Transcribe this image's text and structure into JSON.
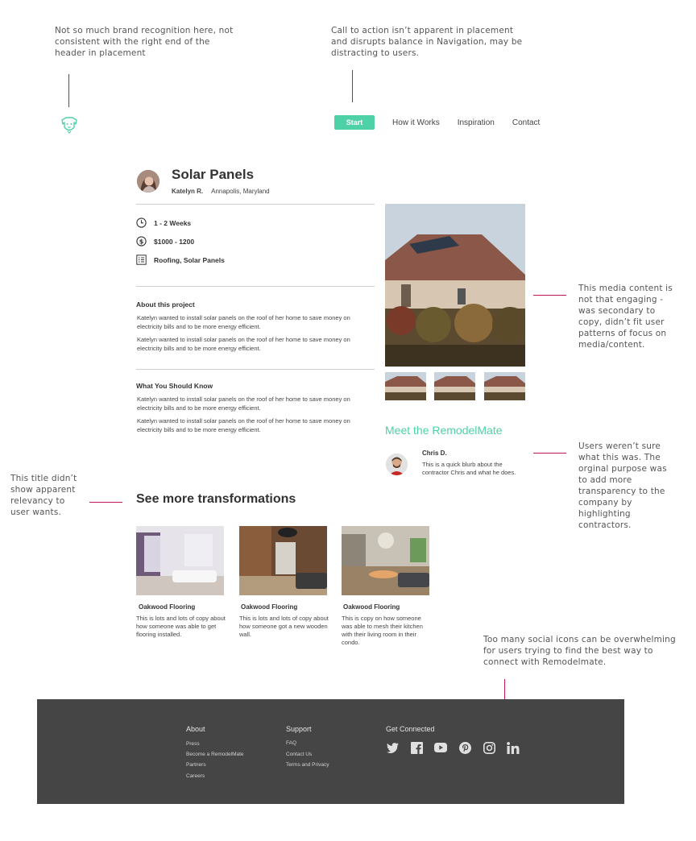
{
  "annotations": {
    "brand": "Not so much brand recognition here, not consistent with the right end of the header in placement",
    "cta": "Call to action isn’t apparent in placement and disrupts balance in Navigation, may be distracting to users.",
    "media": "This media content is not that engaging - was secondary to copy, didn’t fit user patterns of focus on media/content.",
    "contractor": "Users weren’t sure what this was. The orginal purpose was to add more transparency to the company by highlighting contractors.",
    "title": "This title didn’t show apparent relevancy to user wants.",
    "social": "Too many social icons can be overwhelming for users trying to find the best way to connect with Remodelmate."
  },
  "nav": {
    "cta_label": "Start",
    "links": [
      "How it Works",
      "Inspiration",
      "Contact"
    ]
  },
  "project": {
    "title": "Solar Panels",
    "author": "Katelyn R.",
    "location": "Annapolis, Maryland",
    "duration": "1 - 2 Weeks",
    "budget": "$1000 - 1200",
    "category": "Roofing, Solar Panels",
    "about_title": "About this project",
    "about_p1": "Katelyn wanted to install solar panels on the roof of her home to save money on electricity bills and to be more energy efficient.",
    "about_p2": "Katelyn wanted to install solar panels on the roof of her home to save money on electricity bills and to be more energy efficient.",
    "know_title": "What You Should Know",
    "know_p1": "Katelyn wanted to install solar panels on the roof of her home to save money on electricity bills and to be more energy efficient.",
    "know_p2": "Katelyn wanted to install solar panels on the roof of her home to save money on electricity bills and to be more energy efficient."
  },
  "remodelmate": {
    "heading": "Meet the RemodelMate",
    "name": "Chris D.",
    "blurb": "This is a quick blurb about the contractor Chris and what he does."
  },
  "transformations": {
    "heading": "See more transformations",
    "cards": [
      {
        "title": "Oakwood Flooring",
        "desc": "This is lots and lots of copy about how someone was able to get flooring installed."
      },
      {
        "title": "Oakwood Flooring",
        "desc": "This is lots and lots of copy about how someone got a new wooden wall."
      },
      {
        "title": "Oakwood Flooring",
        "desc": "This is copy on how someone was able to mesh their kitchen with their living room in their condo."
      }
    ]
  },
  "footer": {
    "about_title": "About",
    "about_links": [
      "Press",
      "Become a RemodelMate",
      "Partners",
      "Careers"
    ],
    "support_title": "Support",
    "support_links": [
      "FAQ",
      "Contact Us",
      "Terms and Privacy"
    ],
    "connect_title": "Get Connected",
    "social_icons": [
      "twitter-icon",
      "facebook-icon",
      "youtube-icon",
      "pinterest-icon",
      "instagram-icon",
      "linkedin-icon"
    ]
  },
  "colors": {
    "accent": "#4fd1a7",
    "annotation_line": "#c2185b",
    "footer_bg": "#454545"
  }
}
